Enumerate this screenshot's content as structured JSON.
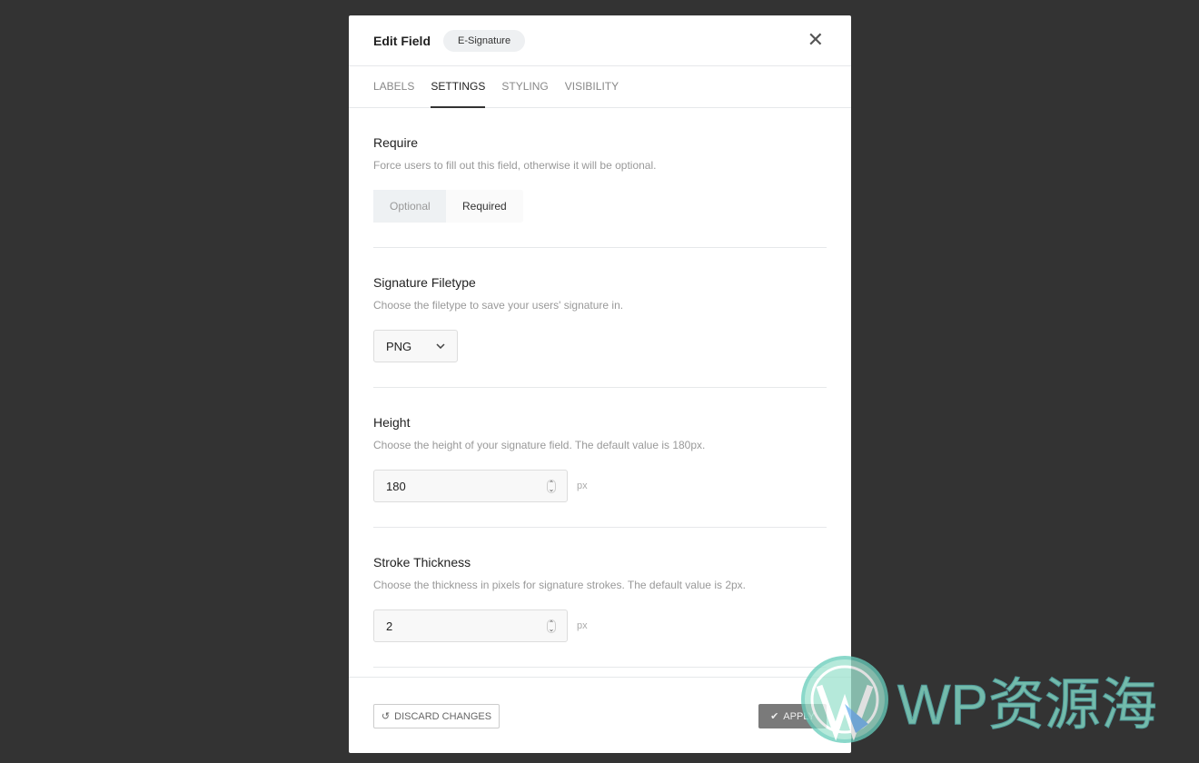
{
  "header": {
    "title": "Edit Field",
    "badge": "E-Signature",
    "close_icon": "close-icon"
  },
  "tabs": [
    {
      "label": "LABELS"
    },
    {
      "label": "SETTINGS",
      "active": true
    },
    {
      "label": "STYLING"
    },
    {
      "label": "VISIBILITY"
    }
  ],
  "require": {
    "title": "Require",
    "desc": "Force users to fill out this field, otherwise it will be optional.",
    "options": [
      "Optional",
      "Required"
    ],
    "selected": "Required"
  },
  "filetype": {
    "title": "Signature Filetype",
    "desc": "Choose the filetype to save your users' signature in.",
    "value": "PNG"
  },
  "height": {
    "title": "Height",
    "desc": "Choose the height of your signature field. The default value is 180px.",
    "value": "180",
    "unit": "px"
  },
  "stroke": {
    "title": "Stroke Thickness",
    "desc": "Choose the thickness in pixels for signature strokes. The default value is 2px.",
    "value": "2",
    "unit": "px"
  },
  "footer": {
    "discard": "DISCARD CHANGES",
    "apply": "APPLY"
  },
  "watermark": {
    "text": "WP资源海"
  },
  "colors": {
    "backdrop": "#333333",
    "apply": "#7a7a7a"
  }
}
